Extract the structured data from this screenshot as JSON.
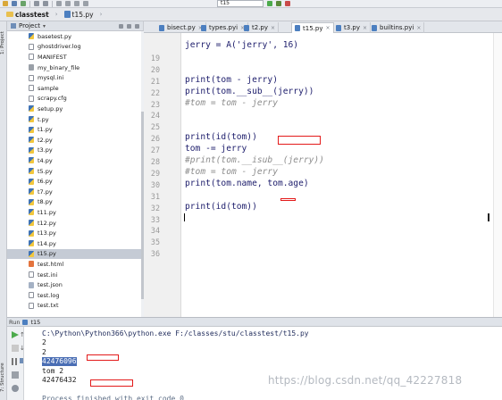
{
  "breadcrumb": {
    "project": "classtest",
    "file": "t15.py"
  },
  "run_config": {
    "selected": "t15"
  },
  "project_panel": {
    "title": "Project",
    "items": [
      {
        "name": "basetest.py",
        "icon": "py"
      },
      {
        "name": "ghostdriver.log",
        "icon": "txt"
      },
      {
        "name": "MANIFEST",
        "icon": "txt"
      },
      {
        "name": "my_binary_file",
        "icon": "bin"
      },
      {
        "name": "mysql.ini",
        "icon": "txt"
      },
      {
        "name": "sample",
        "icon": "txt"
      },
      {
        "name": "scrapy.cfg",
        "icon": "txt"
      },
      {
        "name": "setup.py",
        "icon": "py"
      },
      {
        "name": "t.py",
        "icon": "py"
      },
      {
        "name": "t1.py",
        "icon": "py"
      },
      {
        "name": "t2.py",
        "icon": "py"
      },
      {
        "name": "t3.py",
        "icon": "py"
      },
      {
        "name": "t4.py",
        "icon": "py"
      },
      {
        "name": "t5.py",
        "icon": "py"
      },
      {
        "name": "t6.py",
        "icon": "py"
      },
      {
        "name": "t7.py",
        "icon": "py"
      },
      {
        "name": "t8.py",
        "icon": "py"
      },
      {
        "name": "t11.py",
        "icon": "py"
      },
      {
        "name": "t12.py",
        "icon": "py"
      },
      {
        "name": "t13.py",
        "icon": "py"
      },
      {
        "name": "t14.py",
        "icon": "py"
      },
      {
        "name": "t15.py",
        "icon": "py"
      },
      {
        "name": "test.html",
        "icon": "html"
      },
      {
        "name": "test.ini",
        "icon": "txt"
      },
      {
        "name": "test.json",
        "icon": "json"
      },
      {
        "name": "test.log",
        "icon": "txt"
      },
      {
        "name": "test.txt",
        "icon": "txt"
      }
    ],
    "selected_item": "t15.py"
  },
  "tabs": [
    {
      "label": "bisect.py",
      "active": false
    },
    {
      "label": "types.pyi",
      "active": false
    },
    {
      "label": "t2.py",
      "active": false
    },
    {
      "label": "t15.py",
      "active": true
    },
    {
      "label": "t3.py",
      "active": false
    },
    {
      "label": "builtins.pyi",
      "active": false
    }
  ],
  "editor": {
    "lines": [
      {
        "num": "",
        "text": "jerry = A('jerry', 16)",
        "kind": "normal"
      },
      {
        "num": "19",
        "text": "",
        "kind": "normal"
      },
      {
        "num": "20",
        "text": "",
        "kind": "normal"
      },
      {
        "num": "21",
        "text": "print(tom - jerry)",
        "kind": "normal"
      },
      {
        "num": "22",
        "text": "print(tom.__sub__(jerry))",
        "kind": "normal"
      },
      {
        "num": "23",
        "text": "#tom = tom - jerry",
        "kind": "comment"
      },
      {
        "num": "24",
        "text": "",
        "kind": "normal"
      },
      {
        "num": "25",
        "text": "",
        "kind": "normal"
      },
      {
        "num": "26",
        "text": "print(id(tom))",
        "kind": "normal"
      },
      {
        "num": "27",
        "text": "tom -= jerry",
        "kind": "normal"
      },
      {
        "num": "28",
        "text": "#print(tom.__isub__(jerry))",
        "kind": "comment"
      },
      {
        "num": "29",
        "text": "#tom = tom - jerry",
        "kind": "comment"
      },
      {
        "num": "30",
        "text": "print(tom.name, tom.age)",
        "kind": "normal"
      },
      {
        "num": "31",
        "text": "",
        "kind": "normal"
      },
      {
        "num": "32",
        "text": "print(id(tom))",
        "kind": "normal"
      },
      {
        "num": "33",
        "text": "",
        "kind": "normal"
      },
      {
        "num": "34",
        "text": "",
        "kind": "normal"
      },
      {
        "num": "35",
        "text": "",
        "kind": "normal"
      },
      {
        "num": "36",
        "text": "",
        "kind": "normal"
      }
    ],
    "current_line": "33"
  },
  "run_panel": {
    "label": "Run",
    "config": "t15",
    "output": [
      {
        "text": "C:\\Python\\Python366\\python.exe F:/classes/stu/classtest/t15.py",
        "kind": "path"
      },
      {
        "text": "2",
        "kind": "normal"
      },
      {
        "text": "2",
        "kind": "normal"
      },
      {
        "text": "42476096",
        "kind": "sel"
      },
      {
        "text": "tom 2",
        "kind": "normal"
      },
      {
        "text": "42476432",
        "kind": "normal"
      },
      {
        "text": "",
        "kind": "normal"
      },
      {
        "text": "Process finished with exit code 0",
        "kind": "finished"
      }
    ]
  },
  "side_labels": {
    "project": "1: Project",
    "structure": "7: Structure"
  },
  "watermark": "https://blog.csdn.net/qq_42227818",
  "colors": {
    "annotation_red": "#e31a1a",
    "selection_blue": "#4a6eb4",
    "caret_line": "#fbf7e3"
  }
}
